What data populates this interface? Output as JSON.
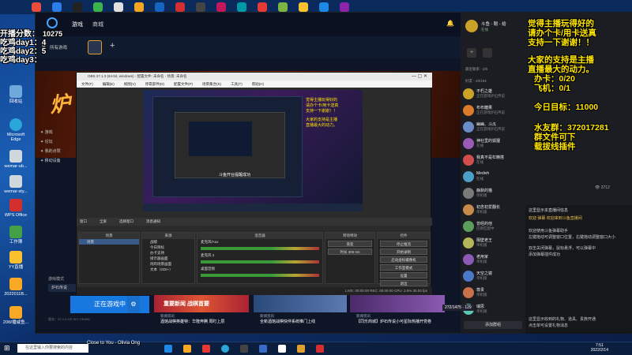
{
  "overlay_left": {
    "line1": "开播分数：",
    "line2": "吃鸡day1：",
    "line3": "吃鸡day2：",
    "line4": "吃鸡day3：",
    "v1": "4",
    "v2": "5"
  },
  "overlay_right": {
    "l1": "觉得主播玩得好的",
    "l2": "请办个卡/用卡送真",
    "l3": "支持一下谢谢！！",
    "l4": "大家的支持是主播",
    "l5": "直播最大的动力。",
    "l6": "办卡：0/20",
    "l7": "飞机：0/1",
    "l8": "今日目标：11000",
    "l9": "水友群：372017281",
    "l10": "群文件可下",
    "l11": "载拔线插件"
  },
  "desktop_icons": [
    "回收站",
    "Microsoft Edge",
    "wemar-ub...",
    "wemar-sty...",
    "WPS Office",
    "工作簿",
    "YY直播",
    "2022011B...",
    "20W播咸鱼...",
    "..."
  ],
  "client": {
    "count": "10275",
    "nav": [
      "游戏",
      "商城"
    ],
    "tab_all": "所有游戏",
    "tab_add": "+",
    "left_items": [
      "游戏",
      "论坛",
      "我的点赞",
      "移动设备"
    ],
    "live_btn": "正在游戏中",
    "live_sub": "版本：22.3.2.137.007.130851",
    "store_label": "炉石传说",
    "dl": "游戏模式",
    "cards": [
      {
        "tag": "新闻资讯",
        "title": "酒馆战棋英雄特：华隆奔腾 周盯上层",
        "art": "重要新闻 战棋首要"
      },
      {
        "tag": "新闻资讯",
        "title": "全新酒馆战棋快伴系统推门上线",
        "art": ""
      },
      {
        "tag": "新闻资讯",
        "title": "【同乐商城】炉石传说小可星际热播开党卷",
        "art": ""
      }
    ],
    "bottom_num": "272/1475",
    "bottom_num2": "129"
  },
  "obs": {
    "title": "OBS 27.1.3 (64-bit, windows) - 配置文件: 未命名 - 场景: 未命名",
    "menu": [
      "文件(F)",
      "编辑(E)",
      "视图(V)",
      "停靠部件(D)",
      "配置文件(P)",
      "场景集合(S)",
      "工具(T)",
      "帮助(H)"
    ],
    "source_bar": [
      "窗口",
      "全屏",
      "选择窗口",
      "消息通知"
    ],
    "scenes_h": "场景",
    "scenes": [
      "场景"
    ],
    "sources_h": "来源",
    "sources": [
      "战绩",
      "今日目标",
      "办卡支持",
      "接示器画面",
      "炖鸡场景画面",
      "文本（GDI+）"
    ],
    "mixer_h": "混音器",
    "mixer": [
      "麦克风/Aux",
      "麦克风 2",
      "桌面音频"
    ],
    "trans_h": "转场特效",
    "trans": [
      "渐变",
      "时长 300 ms"
    ],
    "ctrl_h": "控件",
    "ctrl": [
      "停止推流",
      "开始录制",
      "启动虚拟摄像机",
      "工作室模式",
      "设置",
      "退出"
    ],
    "status": "LIVE: 00:00:00   REC: 00:00:00   CPU: 3.5%   30.00 fps",
    "preview_text": "斗鱼开台提醒成功"
  },
  "chat": {
    "me_name": "斗鱼 - 聪 - 给",
    "me_status": "在线",
    "group_recent": "最近联系 - 0/0",
    "group_friends": "好友 - 20/194",
    "friends": [
      {
        "name": "不朽之雄",
        "status": "正在游戏炉石传说",
        "color": "#c9a227"
      },
      {
        "name": "布布糖果",
        "status": "正在游戏炉石传说",
        "color": "#d97b2a"
      },
      {
        "name": "幽幽、斗瓜",
        "status": "正在游戏炉石传说",
        "color": "#6a8cc7"
      },
      {
        "name": "神社里的狐狸",
        "status": "在线",
        "color": "#9a5bb5"
      },
      {
        "name": "我真不是杠精搭",
        "status": "在线",
        "color": "#d24d4d"
      },
      {
        "name": "Medivh",
        "status": "在线",
        "color": "#4aa0c7"
      },
      {
        "name": "静默的猫",
        "status": "单机版",
        "color": "#7a7a7a"
      },
      {
        "name": "初念初爱翻长",
        "status": "单机版",
        "color": "#c78a4a"
      },
      {
        "name": "曾经的他",
        "status": "巴斯匹配中",
        "color": "#5aa05a"
      },
      {
        "name": "隔壁老王",
        "status": "单机版",
        "color": "#b5b55a"
      },
      {
        "name": "老用家",
        "status": "单机版",
        "color": "#8a5ab5"
      },
      {
        "name": "天空之镜",
        "status": "单机版",
        "color": "#4a7ac7"
      },
      {
        "name": "尊贵",
        "status": "单机版",
        "color": "#c7714a"
      },
      {
        "name": "瑞思",
        "status": "单机版",
        "color": "#5ac7b5"
      }
    ],
    "add_group": "添加群组",
    "room_msgs": [
      "这里显示本直播间信息",
      "欢迎 弹幕 欢迎来到斗鱼直播间",
      "欢迎使用斗鱼弹幕助手",
      "左键拖动可调整窗口位置，右键拖动调整窗口大小",
      "双击关闭弹幕，鼠标悬浮，可以弹幕中",
      "添加弹幕插件成功",
      "这里显示收到的礼物、道具、贵族开通",
      "点击单可设置礼物消息"
    ],
    "viewer_count": "3712"
  },
  "taskbar": {
    "search": "在这里输入你要搜索的内容",
    "music": "Close to You - Olivia Ong",
    "time": "7:51",
    "date": "2022/2/14"
  }
}
